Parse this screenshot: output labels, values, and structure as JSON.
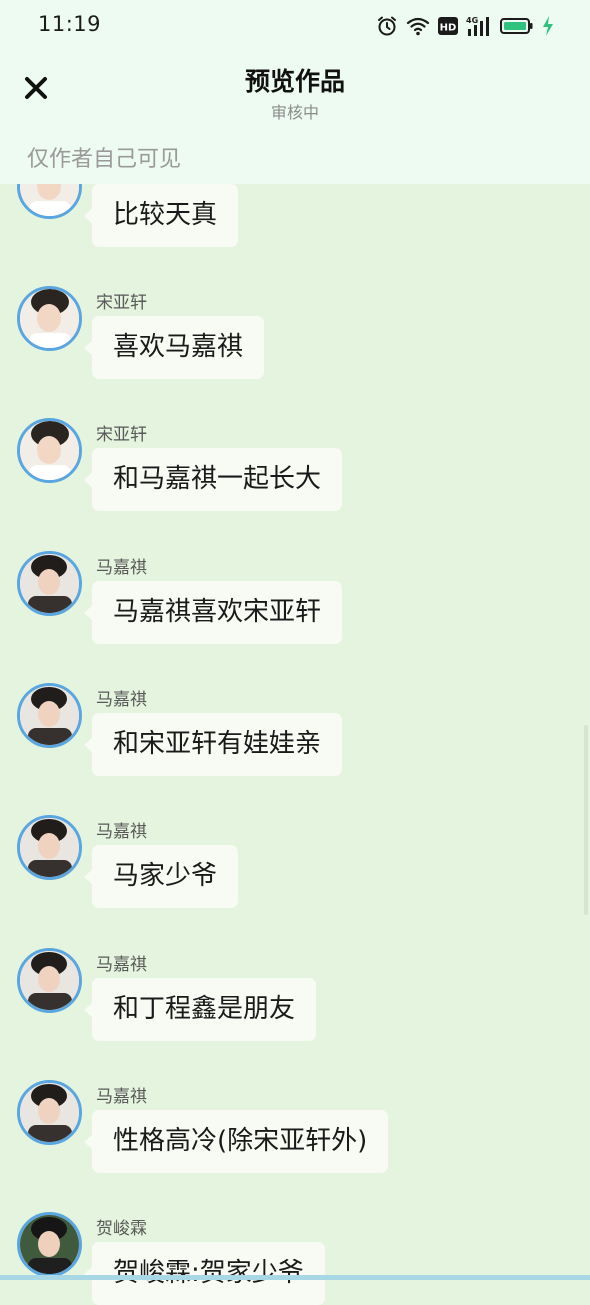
{
  "status_bar": {
    "time": "11:19",
    "hd_label": "HD",
    "network_label": "4G",
    "icons": [
      "alarm-icon",
      "wifi-icon",
      "hd-icon",
      "signal-icon",
      "battery-icon",
      "charging-icon"
    ]
  },
  "header": {
    "title": "预览作品",
    "subtitle": "审核中",
    "close_icon": "close-icon",
    "notice": "仅作者自己可见"
  },
  "colors": {
    "background": "#e4f4de",
    "header_background": "#eefbf2",
    "bubble": "#f7fbf4",
    "avatar_border": "#5aa6e0",
    "battery_fill": "#2ec27e"
  },
  "messages": [
    {
      "sender": "",
      "text": "比较天真",
      "avatar": "avatar-songyaxuan"
    },
    {
      "sender": "宋亚轩",
      "text": "喜欢马嘉祺",
      "avatar": "avatar-songyaxuan"
    },
    {
      "sender": "宋亚轩",
      "text": "和马嘉祺一起长大",
      "avatar": "avatar-songyaxuan"
    },
    {
      "sender": "马嘉祺",
      "text": "马嘉祺喜欢宋亚轩",
      "avatar": "avatar-majiaqi"
    },
    {
      "sender": "马嘉祺",
      "text": "和宋亚轩有娃娃亲",
      "avatar": "avatar-majiaqi"
    },
    {
      "sender": "马嘉祺",
      "text": "马家少爷",
      "avatar": "avatar-majiaqi"
    },
    {
      "sender": "马嘉祺",
      "text": "和丁程鑫是朋友",
      "avatar": "avatar-majiaqi"
    },
    {
      "sender": "马嘉祺",
      "text": "性格高冷(除宋亚轩外)",
      "avatar": "avatar-majiaqi"
    },
    {
      "sender": "贺峻霖",
      "text": "贺峻霖:贺家少爷",
      "avatar": "avatar-hejunlin"
    }
  ]
}
